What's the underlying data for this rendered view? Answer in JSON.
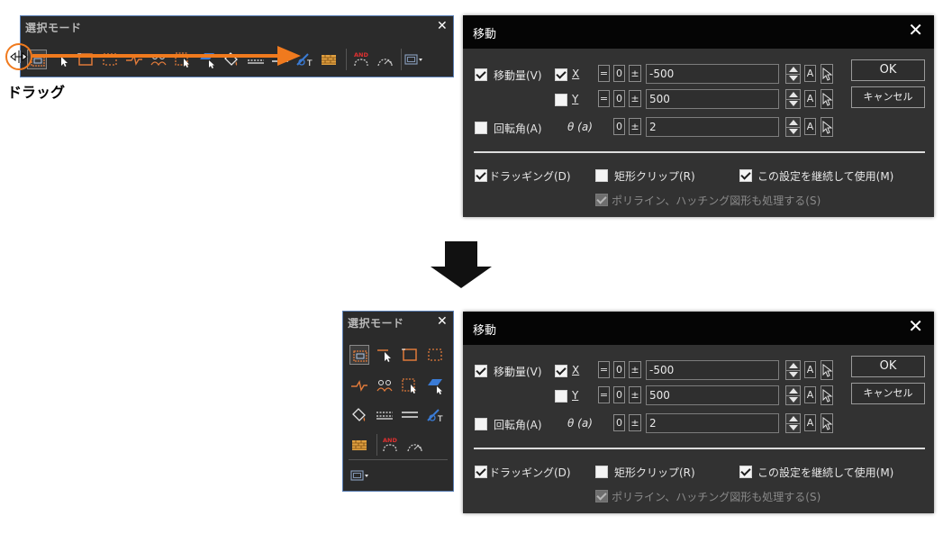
{
  "palette": {
    "title": "選択モード",
    "close": "✕",
    "tools": [
      {
        "name": "tool-select-mode-icon"
      },
      {
        "name": "tool-pick-icon"
      },
      {
        "name": "tool-rectangle-icon"
      },
      {
        "name": "tool-crossing-rect-icon"
      },
      {
        "name": "tool-fence-icon"
      },
      {
        "name": "tool-group-icon"
      },
      {
        "name": "tool-window-pick-icon"
      },
      {
        "name": "tool-layer-icon"
      },
      {
        "name": "tool-fill-icon"
      },
      {
        "name": "tool-dashed-line-icon"
      },
      {
        "name": "tool-double-line-icon"
      },
      {
        "name": "tool-text-icon"
      },
      {
        "name": "tool-hatch-icon"
      },
      {
        "name": "tool-and-search-icon"
      },
      {
        "name": "tool-or-search-icon"
      },
      {
        "name": "tool-mode-dropdown-icon"
      }
    ]
  },
  "annotation": {
    "drag_label": "ドラッグ"
  },
  "dialog": {
    "title": "移動",
    "close": "✕",
    "move_amount": {
      "label": "移動量(V)",
      "checked": true
    },
    "x": {
      "label": "X",
      "checked": true,
      "eq": "=",
      "zero": "0",
      "pm": "±",
      "value": "-500",
      "a": "A"
    },
    "y": {
      "label": "Y",
      "checked": false,
      "eq": "=",
      "zero": "0",
      "pm": "±",
      "value": "500",
      "a": "A"
    },
    "rotate": {
      "label": "回転角(A)",
      "checked": false,
      "theta": "θ (a)",
      "zero": "0",
      "pm": "±",
      "value": "2",
      "a": "A"
    },
    "ok": "OK",
    "cancel": "キャンセル",
    "dragging": {
      "label": "ドラッギング(D)",
      "checked": true
    },
    "rect_clip": {
      "label": "矩形クリップ(R)",
      "checked": false
    },
    "keep_setting": {
      "label": "この設定を継続して使用(M)",
      "checked": true
    },
    "polyline": {
      "label": "ポリライン、ハッチング図形も処理する(S)",
      "checked": true,
      "disabled": true
    }
  },
  "colors": {
    "accent_orange": "#f07a1e",
    "palette_border": "#5a7fb5",
    "title_bar": "#050505",
    "panel": "#323232"
  }
}
